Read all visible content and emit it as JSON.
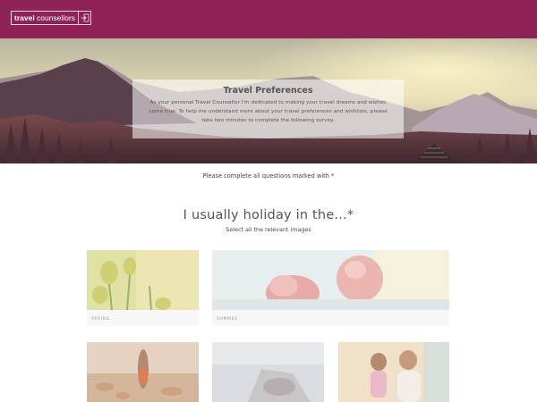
{
  "header": {
    "logo_bold": "travel",
    "logo_rest": " counsellors",
    "logo_icon": "arrow-into-box-icon",
    "brand_color": "#8e2255"
  },
  "intro": {
    "title": "Travel Preferences",
    "body": "As your personal Travel Counsellor I'm dedicated to making your travel dreams and wishes come true. To help me understand more about your travel preferences and wishlists, please take two minutes to complete the following survey."
  },
  "notice": "Please complete all questions marked with *",
  "question": {
    "title": "I usually holiday in the...*",
    "subtitle": "Select all the relevant images",
    "options": [
      {
        "label": "SPRING"
      },
      {
        "label": "SUMMER"
      },
      {
        "label": ""
      },
      {
        "label": ""
      },
      {
        "label": ""
      }
    ]
  }
}
